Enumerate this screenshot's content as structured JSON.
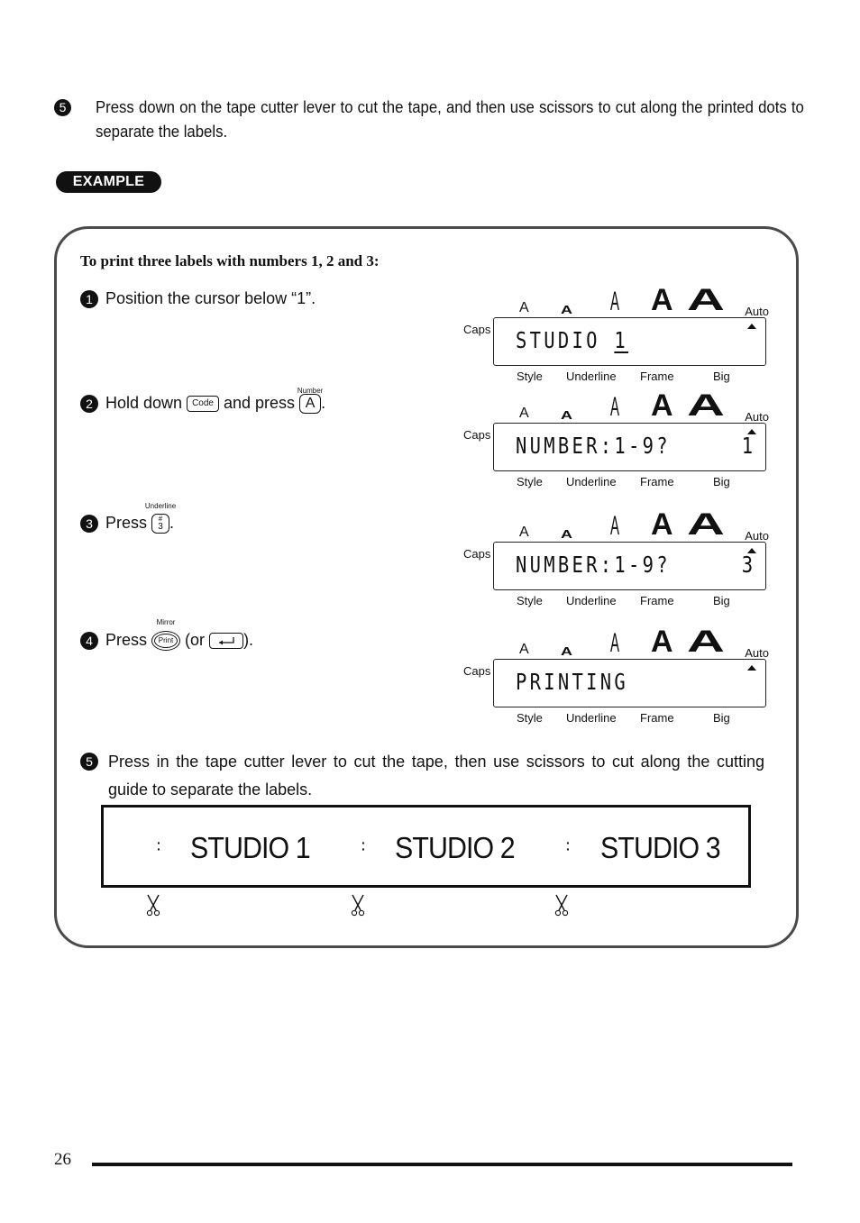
{
  "top_step": {
    "number": "5",
    "text": "Press down on the tape cutter lever to cut the tape, and then use scissors to cut along the printed dots to separate the labels."
  },
  "example_badge": "EXAMPLE",
  "example": {
    "heading": "To print three labels with numbers 1, 2 and 3:",
    "steps": [
      {
        "number": "1",
        "text": "Position the cursor below “1”."
      },
      {
        "number": "2",
        "text_before": "Hold down",
        "key1": "Code",
        "text_mid": "and press",
        "key2": "A",
        "key2_label": "Number",
        "text_after": "."
      },
      {
        "number": "3",
        "text_before": "Press",
        "key": "#\n3",
        "key_top": "#",
        "key_bottom": "3",
        "key_label": "Underline",
        "text_after": "."
      },
      {
        "number": "4",
        "text_before": "Press",
        "key": "Print",
        "key_label": "Mirror",
        "text_mid": "(or",
        "alt_key_icon": "enter-arrow-icon",
        "text_after": ")."
      },
      {
        "number": "5",
        "text": "Press in the tape cutter lever to cut the tape, then use scissors to cut along the cutting guide to separate the labels."
      }
    ],
    "lcd_common": {
      "size_glyphs": [
        "A",
        "A",
        "A",
        "A",
        "A"
      ],
      "auto_label": "Auto",
      "caps_label": "Caps",
      "bottom_labels": [
        "Style",
        "Underline",
        "Frame",
        "Big"
      ]
    },
    "lcds": [
      {
        "text_main": "STUDIO ",
        "text_cursor": "1",
        "right_value": ""
      },
      {
        "text_main": "NUMBER:1-9?",
        "text_cursor": "",
        "right_value": "1"
      },
      {
        "text_main": "NUMBER:1-9?",
        "text_cursor": "",
        "right_value": "3"
      },
      {
        "text_main": "PRINTING",
        "text_cursor": "",
        "right_value": ""
      }
    ],
    "tape_labels": [
      "STUDIO 1",
      "STUDIO 2",
      "STUDIO 3"
    ],
    "cut_marks": [
      "scissors-icon",
      "scissors-icon",
      "scissors-icon"
    ]
  },
  "footer": {
    "page_number": "26"
  }
}
